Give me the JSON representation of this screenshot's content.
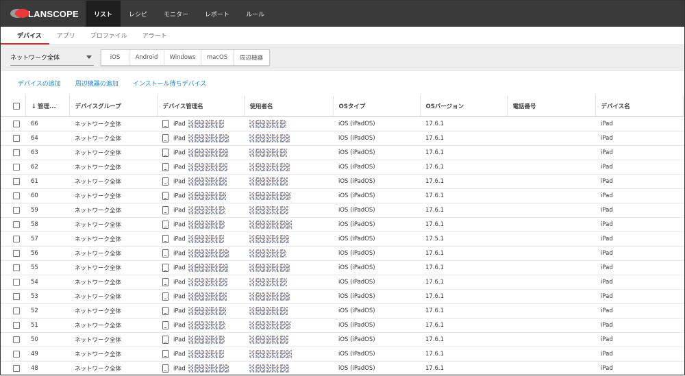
{
  "app": {
    "logo_text": "LANSCOPE"
  },
  "nav": {
    "tabs": [
      "リスト",
      "レシピ",
      "モニター",
      "レポート",
      "ルール"
    ]
  },
  "subnav": {
    "tabs": [
      "デバイス",
      "アプリ",
      "プロファイル",
      "アラート"
    ]
  },
  "filter": {
    "group_select": "ネットワーク全体",
    "os_buttons": [
      "iOS",
      "Android",
      "Windows",
      "macOS",
      "周辺機器"
    ]
  },
  "actions": [
    "デバイスの追加",
    "周辺機器の追加",
    "インストール待ちデバイス"
  ],
  "table": {
    "headers": [
      "管理...",
      "デバイスグループ",
      "デバイス管理名",
      "使用者名",
      "OSタイプ",
      "OSバージョン",
      "電話番号",
      "デバイス名"
    ],
    "rows": [
      {
        "id": "66",
        "group": "ネットワーク全体",
        "device_prefix": "iPad",
        "os_type": "iOS (iPadOS)",
        "os_version": "17.6.1",
        "device_name": "iPad"
      },
      {
        "id": "64",
        "group": "ネットワーク全体",
        "device_prefix": "iPad",
        "os_type": "iOS (iPadOS)",
        "os_version": "17.6.1",
        "device_name": "iPad"
      },
      {
        "id": "63",
        "group": "ネットワーク全体",
        "device_prefix": "iPad",
        "os_type": "iOS (iPadOS)",
        "os_version": "17.6.1",
        "device_name": "iPad"
      },
      {
        "id": "62",
        "group": "ネットワーク全体",
        "device_prefix": "iPad",
        "os_type": "iOS (iPadOS)",
        "os_version": "17.6.1",
        "device_name": "iPad"
      },
      {
        "id": "61",
        "group": "ネットワーク全体",
        "device_prefix": "iPad",
        "os_type": "iOS (iPadOS)",
        "os_version": "17.6.1",
        "device_name": "iPad"
      },
      {
        "id": "60",
        "group": "ネットワーク全体",
        "device_prefix": "iPad",
        "os_type": "iOS (iPadOS)",
        "os_version": "17.6.1",
        "device_name": "iPad"
      },
      {
        "id": "59",
        "group": "ネットワーク全体",
        "device_prefix": "iPad",
        "os_type": "iOS (iPadOS)",
        "os_version": "17.6.1",
        "device_name": "iPad"
      },
      {
        "id": "58",
        "group": "ネットワーク全体",
        "device_prefix": "iPad",
        "os_type": "iOS (iPadOS)",
        "os_version": "17.6.1",
        "device_name": "iPad"
      },
      {
        "id": "57",
        "group": "ネットワーク全体",
        "device_prefix": "iPad",
        "os_type": "iOS (iPadOS)",
        "os_version": "17.5.1",
        "device_name": "iPad"
      },
      {
        "id": "56",
        "group": "ネットワーク全体",
        "device_prefix": "iPad",
        "os_type": "iOS (iPadOS)",
        "os_version": "17.6.1",
        "device_name": "iPad"
      },
      {
        "id": "55",
        "group": "ネットワーク全体",
        "device_prefix": "iPad",
        "os_type": "iOS (iPadOS)",
        "os_version": "17.6.1",
        "device_name": "iPad"
      },
      {
        "id": "54",
        "group": "ネットワーク全体",
        "device_prefix": "iPad",
        "os_type": "iOS (iPadOS)",
        "os_version": "17.6.1",
        "device_name": "iPad"
      },
      {
        "id": "53",
        "group": "ネットワーク全体",
        "device_prefix": "iPad",
        "os_type": "iOS (iPadOS)",
        "os_version": "17.6.1",
        "device_name": "iPad"
      },
      {
        "id": "52",
        "group": "ネットワーク全体",
        "device_prefix": "iPad",
        "os_type": "iOS (iPadOS)",
        "os_version": "17.6.1",
        "device_name": "iPad"
      },
      {
        "id": "51",
        "group": "ネットワーク全体",
        "device_prefix": "iPad",
        "os_type": "iOS (iPadOS)",
        "os_version": "17.6.1",
        "device_name": "iPad"
      },
      {
        "id": "50",
        "group": "ネットワーク全体",
        "device_prefix": "iPad",
        "os_type": "iOS (iPadOS)",
        "os_version": "17.6.1",
        "device_name": "iPad"
      },
      {
        "id": "49",
        "group": "ネットワーク全体",
        "device_prefix": "iPad",
        "os_type": "iOS (iPadOS)",
        "os_version": "17.6.1",
        "device_name": "iPad"
      },
      {
        "id": "48",
        "group": "ネットワーク全体",
        "device_prefix": "iPad",
        "os_type": "iOS (iPadOS)",
        "os_version": "17.6.1",
        "device_name": "iPad"
      }
    ]
  }
}
